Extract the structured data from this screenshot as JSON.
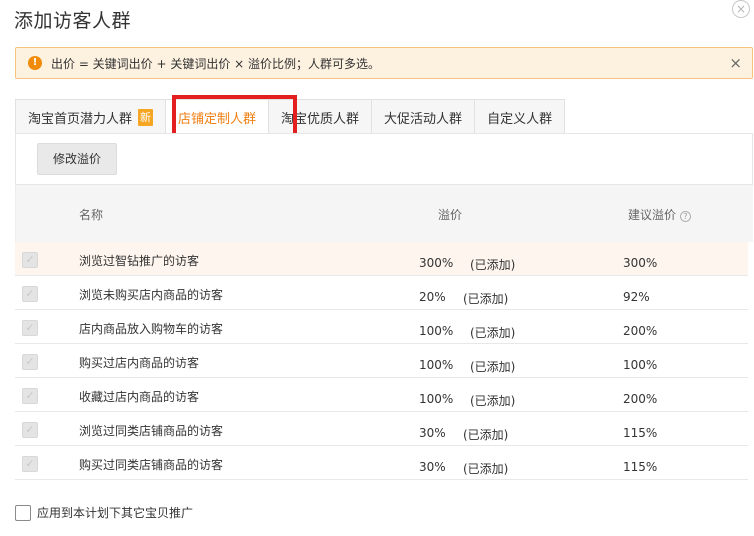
{
  "dialog": {
    "title": "添加访客人群",
    "close_glyph": "×"
  },
  "notice": {
    "icon_glyph": "!",
    "text": "出价 = 关键词出价 + 关键词出价 × 溢价比例；人群可多选。",
    "close_glyph": "×"
  },
  "tabs": [
    {
      "label": "淘宝首页潜力人群",
      "badge": "新",
      "active": false
    },
    {
      "label": "店铺定制人群",
      "active": true
    },
    {
      "label": "淘宝优质人群",
      "active": false
    },
    {
      "label": "大促活动人群",
      "active": false
    },
    {
      "label": "自定义人群",
      "active": false
    }
  ],
  "toolbar": {
    "modify_label": "修改溢价"
  },
  "table": {
    "headers": {
      "name": "名称",
      "premium": "溢价",
      "suggest": "建议溢价",
      "help_glyph": "?"
    },
    "rows": [
      {
        "name": "浏览过智钻推广的访客",
        "premium": "300%",
        "status": "(已添加)",
        "suggest": "300%"
      },
      {
        "name": "浏览未购买店内商品的访客",
        "premium": "20%",
        "status": "(已添加)",
        "suggest": "92%"
      },
      {
        "name": "店内商品放入购物车的访客",
        "premium": "100%",
        "status": "(已添加)",
        "suggest": "200%"
      },
      {
        "name": "购买过店内商品的访客",
        "premium": "100%",
        "status": "(已添加)",
        "suggest": "100%"
      },
      {
        "name": "收藏过店内商品的访客",
        "premium": "100%",
        "status": "(已添加)",
        "suggest": "200%"
      },
      {
        "name": "浏览过同类店铺商品的访客",
        "premium": "30%",
        "status": "(已添加)",
        "suggest": "115%"
      },
      {
        "name": "购买过同类店铺商品的访客",
        "premium": "30%",
        "status": "(已添加)",
        "suggest": "115%"
      }
    ]
  },
  "footer": {
    "apply_all_label": "应用到本计划下其它宝贝推广"
  },
  "colors": {
    "accent": "#f07f13",
    "highlight_border": "#e41f1f",
    "notice_bg": "#fdf1e0",
    "notice_icon": "#f08c0a"
  }
}
